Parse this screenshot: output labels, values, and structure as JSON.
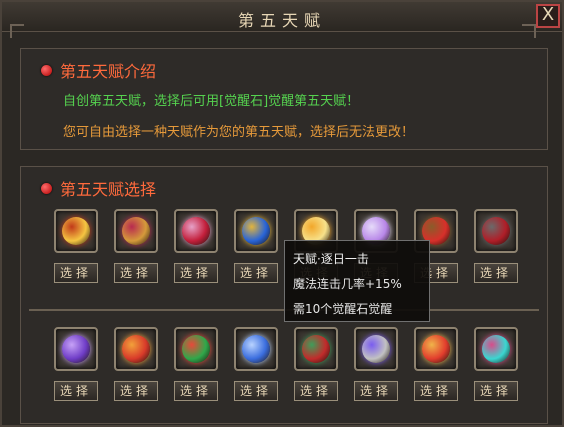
{
  "window": {
    "title": "第五天赋",
    "close_label": "X"
  },
  "intro": {
    "title": "第五天赋介绍",
    "line1": "自创第五天赋，选择后可用[觉醒石]觉醒第五天赋！",
    "line2": "您可自由选择一种天赋作为您的第五天赋，选择后无法更改！"
  },
  "choose": {
    "title": "第五天赋选择",
    "select_label": "选择"
  },
  "tooltip": {
    "line1": "天赋·逐日一击",
    "line2": "魔法连击几率+15%",
    "line3": "需10个觉醒石觉醒"
  },
  "gems": {
    "row1": [
      {
        "icon": "golden-lion-emblem-icon",
        "colors": [
          "#f5c542",
          "#c13a1a"
        ]
      },
      {
        "icon": "jeweled-pendant-icon",
        "colors": [
          "#d59a3b",
          "#b82a4f"
        ]
      },
      {
        "icon": "red-orb-sword-icon",
        "colors": [
          "#c31f3b",
          "#e6a2c8"
        ]
      },
      {
        "icon": "yin-yang-icon",
        "colors": [
          "#2864d8",
          "#e3b53c"
        ]
      },
      {
        "icon": "golden-sun-icon",
        "colors": [
          "#f7e18a",
          "#f2a72a"
        ]
      },
      {
        "icon": "purple-star-icon",
        "colors": [
          "#b887e8",
          "#e6dbf9"
        ]
      },
      {
        "icon": "red-eye-gem-icon",
        "colors": [
          "#d7302a",
          "#8a5c2a"
        ]
      },
      {
        "icon": "dark-red-gem-icon",
        "colors": [
          "#b01e28",
          "#6a6a6a"
        ]
      }
    ],
    "row2": [
      {
        "icon": "violet-crystal-icon",
        "colors": [
          "#6f3dc7",
          "#c7a2f7"
        ]
      },
      {
        "icon": "crimson-orb-icon",
        "colors": [
          "#d83a2a",
          "#f2a13a"
        ]
      },
      {
        "icon": "rainbow-swirl-icon",
        "colors": [
          "#2fa84a",
          "#e8493a"
        ]
      },
      {
        "icon": "blue-sapphire-icon",
        "colors": [
          "#3a6dde",
          "#b9d3ff"
        ]
      },
      {
        "icon": "red-orb-green-gem-icon",
        "colors": [
          "#c22b2b",
          "#3f9d5a"
        ]
      },
      {
        "icon": "silver-shield-icon",
        "colors": [
          "#c2c2c2",
          "#7a5cf0"
        ]
      },
      {
        "icon": "red-star-gem-icon",
        "colors": [
          "#e23d2d",
          "#f0b44a"
        ]
      },
      {
        "icon": "cyan-orb-icon",
        "colors": [
          "#3bd6d1",
          "#d84c8a"
        ]
      }
    ]
  }
}
